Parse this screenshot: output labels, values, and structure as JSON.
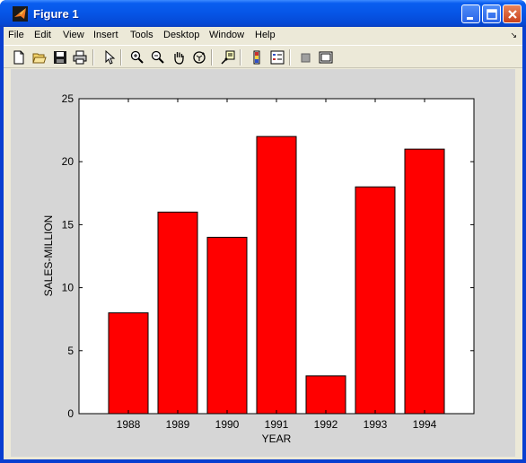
{
  "window": {
    "title": "Figure 1"
  },
  "menu": {
    "items": [
      "File",
      "Edit",
      "View",
      "Insert",
      "Tools",
      "Desktop",
      "Window",
      "Help"
    ],
    "overflow_arrow": "↘"
  },
  "toolbar": {
    "buttons": [
      "new-figure-icon",
      "open-file-icon",
      "save-icon",
      "print-icon",
      "edit-plot-arrow-icon",
      "zoom-in-icon",
      "zoom-out-icon",
      "pan-hand-icon",
      "rotate-3d-icon",
      "data-cursor-icon",
      "insert-colorbar-icon",
      "insert-legend-icon",
      "hide-plot-tools-icon",
      "show-plot-tools-icon"
    ]
  },
  "colors": {
    "bar": "#ff0000",
    "figure_bg": "#d6d6d6",
    "axes_bg": "#ffffff",
    "titlebar": "#0655e6"
  },
  "chart_data": {
    "type": "bar",
    "categories": [
      "1988",
      "1989",
      "1990",
      "1991",
      "1992",
      "1993",
      "1994"
    ],
    "values": [
      8,
      16,
      14,
      22,
      3,
      18,
      21
    ],
    "title": "",
    "xlabel": "YEAR",
    "ylabel": "SALES-MILLION",
    "ylim": [
      0,
      25
    ],
    "yticks": [
      "0",
      "5",
      "10",
      "15",
      "20",
      "25"
    ],
    "grid": false
  }
}
